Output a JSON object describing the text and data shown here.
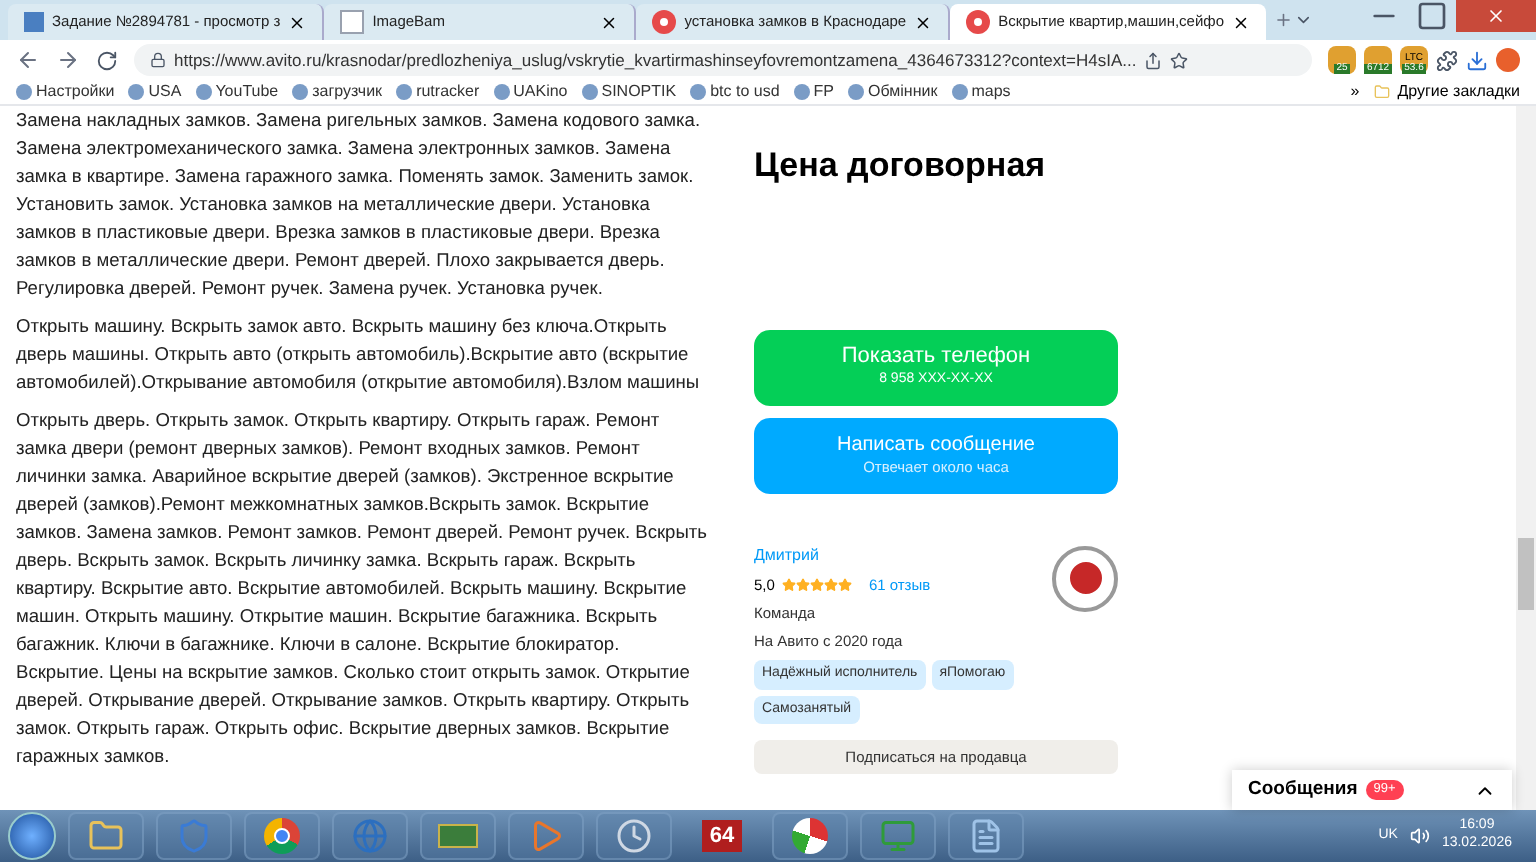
{
  "browser": {
    "tabs": [
      {
        "title": "Задание №2894781 - просмотр з",
        "selected": false
      },
      {
        "title": "ImageBam",
        "selected": false
      },
      {
        "title": "установка замков в Краснодаре",
        "selected": false
      },
      {
        "title": "Вскрытие квартир,машин,сейфо",
        "selected": true
      }
    ],
    "address": "https://www.avito.ru/krasnodar/predlozheniya_uslug/vskrytie_kvartirmashinseyfovremontzamena_4364673312?context=H4sIA...",
    "extensions": [
      {
        "badge": "25"
      },
      {
        "badge": "6712"
      },
      {
        "badge": "53.6",
        "top": "LTC"
      }
    ],
    "bookmarks": [
      "Настройки",
      "USA",
      "YouTube",
      "загрузчик",
      "rutracker",
      "UAKino",
      "SINOPTIK",
      "btc to usd",
      "FP",
      "Обмінник",
      "maps"
    ],
    "other_bookmarks": "Другие закладки",
    "more": "»"
  },
  "page": {
    "paragraphs": [
      "Замена накладных замков. Замена ригельных замков. Замена кодового замка. Замена электромеханического замка. Замена электронных замков. Замена замка в квартире. Замена гаражного замка. Поменять замок. Заменить замок. Установить замок. Установка замков на металлические двери. Установка замков в пластиковые двери. Врезка замков в пластиковые двери. Врезка замков в металлические двери. Ремонт дверей. Плохо закрывается дверь. Регулировка дверей. Ремонт ручек. Замена ручек. Установка ручек.",
      "Открыть машину. Вскрыть замок авто. Вскрыть машину без ключа.Открыть дверь машины. Открыть авто (открыть автомобиль).Вскрытие авто (вскрытие автомобилей).Открывание автомобиля (открытие автомобиля).Взлом машины",
      "Открыть дверь. Открыть замок. Открыть квартиру. Открыть гараж. Ремонт замка двери (ремонт дверных замков). Ремонт входных замков. Ремонт личинки замка. Аварийное вскрытие дверей (замков). Экстренное вскрытие дверей (замков).Ремонт межкомнатных замков.Вскрыть замок. Вскрытие замков. Замена замков. Ремонт замков. Ремонт дверей. Ремонт ручек. Вскрыть дверь. Вскрыть замок. Вскрыть личинку замка. Вскрыть гараж. Вскрыть квартиру. Вскрытие авто. Вскрытие автомобилей. Вскрыть машину. Вскрытие машин. Открыть машину. Открытие машин. Вскрытие багажника. Вскрыть багажник. Ключи в багажнике. Ключи в салоне. Вскрытие блокиратор. Вскрытие. Цены на вскрытие замков. Сколько стоит открыть замок. Открытие дверей. Открывание дверей. Открывание замков. Открыть квартиру. Открыть замок. Открыть гараж. Открыть офис. Вскрытие дверных замков. Вскрытие гаражных замков."
    ],
    "price": "Цена договорная",
    "phone_button": {
      "label": "Показать телефон",
      "sub": "8 958 XXX-XX-XX"
    },
    "message_button": {
      "label": "Написать сообщение",
      "sub": "Отвечает около часа"
    },
    "seller": {
      "name": "Дмитрий",
      "rating": "5,0",
      "stars": 5,
      "reviews": "61 отзыв",
      "type": "Команда",
      "since": "На Авито с 2020 года",
      "badges": [
        "Надёжный исполнитель",
        "яПомогаю",
        "Самозанятый"
      ],
      "subscribe": "Подписаться на продавца"
    },
    "messages": {
      "label": "Сообщения",
      "count": "99+"
    }
  },
  "taskbar": {
    "app_label": "64",
    "lang": "UK",
    "time": "16:09",
    "date": "13.02.2026"
  }
}
